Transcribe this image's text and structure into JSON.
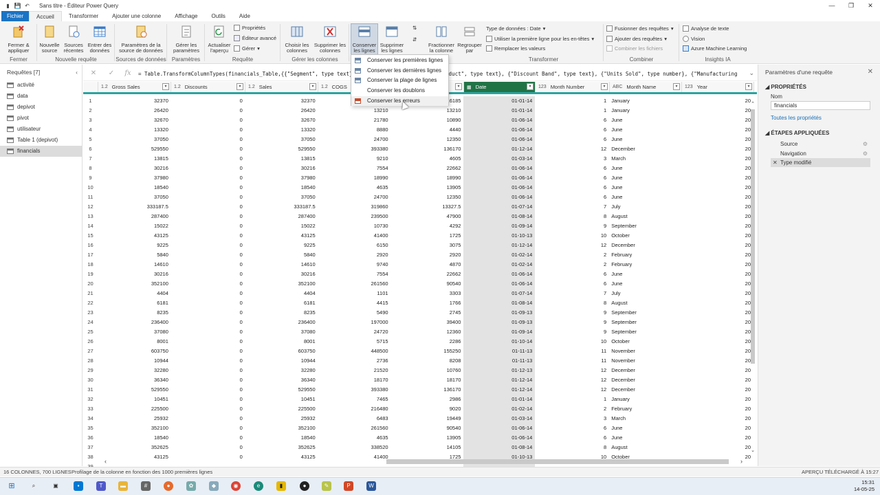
{
  "window": {
    "title": "Sans titre - Éditeur Power Query"
  },
  "menu": {
    "tabs": [
      "Fichier",
      "Accueil",
      "Transformer",
      "Ajouter une colonne",
      "Affichage",
      "Outils",
      "Aide"
    ]
  },
  "ribbon": {
    "close_apply": "Fermer &\nappliquer",
    "new_source": "Nouvelle\nsource",
    "recent_sources": "Sources\nrécentes",
    "enter_data": "Entrer des\ndonnées",
    "source_settings": "Paramètres de la\nsource de données",
    "manage_params": "Gérer les\nparamètres",
    "refresh_preview": "Actualiser\nl'aperçu",
    "properties": "Propriétés",
    "advanced_editor": "Éditeur avancé",
    "manage": "Gérer",
    "choose_columns": "Choisir les\ncolonnes",
    "remove_columns": "Supprimer les\ncolonnes",
    "keep_rows": "Conserver\nles lignes",
    "remove_rows": "Supprimer\nles lignes",
    "split_column": "Fractionner\nla colonne",
    "group_by": "Regrouper\npar",
    "data_type": "Type de données : Date",
    "first_row_headers": "Utiliser la première ligne pour les en-têtes",
    "replace_values": "Remplacer les valeurs",
    "merge_queries": "Fusionner des requêtes",
    "append_queries": "Ajouter des requêtes",
    "combine_files": "Combiner les fichiers",
    "text_analytics": "Analyse de texte",
    "vision": "Vision",
    "azure_ml": "Azure Machine Learning",
    "groups": {
      "close": "Fermer",
      "new_query": "Nouvelle requête",
      "data_sources": "Sources de données",
      "parameters": "Paramètres",
      "query": "Requête",
      "manage_columns": "Gérer les colonnes",
      "transform": "Transformer",
      "combine": "Combiner",
      "ai_insights": "Insights IA"
    }
  },
  "dropdown": {
    "items": [
      "Conserver les premières lignes",
      "Conserver les dernières lignes",
      "Conserver la plage de lignes",
      "Conserver les doublons",
      "Conserver les erreurs"
    ]
  },
  "queries": {
    "header": "Requêtes [7]",
    "items": [
      "activité",
      "data",
      "depivot",
      "pivot",
      "utilisateur",
      "Table 1 (depivot)",
      "financials"
    ]
  },
  "formula": {
    "text": "= Table.TransformColumnTypes(financials_Table,{{\"Segment\", type text}, {\"Country\", type text}, {\"Product\", type text}, {\"Discount Band\", type text}, {\"Units Sold\", type number}, {\"Manufacturing"
  },
  "grid": {
    "columns": [
      {
        "type": "1.2",
        "name": "Gross Sales"
      },
      {
        "type": "1.2",
        "name": "Discounts"
      },
      {
        "type": "1.2",
        "name": "Sales"
      },
      {
        "type": "1.2",
        "name": "COGS"
      },
      {
        "type": "1.2",
        "name": "Profit"
      },
      {
        "type": "▦",
        "name": "Date"
      },
      {
        "type": "123",
        "name": "Month Number"
      },
      {
        "type": "ABC",
        "name": "Month Name"
      },
      {
        "type": "123",
        "name": "Year"
      }
    ],
    "rows": [
      [
        "1",
        "32370",
        "0",
        "32370",
        "16185",
        "16185",
        "01-01-14",
        "1",
        "January",
        "20"
      ],
      [
        "2",
        "26420",
        "0",
        "26420",
        "13210",
        "13210",
        "01-01-14",
        "1",
        "January",
        "20"
      ],
      [
        "3",
        "32670",
        "0",
        "32670",
        "21780",
        "10890",
        "01-06-14",
        "6",
        "June",
        "20"
      ],
      [
        "4",
        "13320",
        "0",
        "13320",
        "8880",
        "4440",
        "01-06-14",
        "6",
        "June",
        "20"
      ],
      [
        "5",
        "37050",
        "0",
        "37050",
        "24700",
        "12350",
        "01-06-14",
        "6",
        "June",
        "20"
      ],
      [
        "6",
        "529550",
        "0",
        "529550",
        "393380",
        "136170",
        "01-12-14",
        "12",
        "December",
        "20"
      ],
      [
        "7",
        "13815",
        "0",
        "13815",
        "9210",
        "4605",
        "01-03-14",
        "3",
        "March",
        "20"
      ],
      [
        "8",
        "30216",
        "0",
        "30216",
        "7554",
        "22662",
        "01-06-14",
        "6",
        "June",
        "20"
      ],
      [
        "9",
        "37980",
        "0",
        "37980",
        "18990",
        "18990",
        "01-06-14",
        "6",
        "June",
        "20"
      ],
      [
        "10",
        "18540",
        "0",
        "18540",
        "4635",
        "13905",
        "01-06-14",
        "6",
        "June",
        "20"
      ],
      [
        "11",
        "37050",
        "0",
        "37050",
        "24700",
        "12350",
        "01-06-14",
        "6",
        "June",
        "20"
      ],
      [
        "12",
        "333187.5",
        "0",
        "333187.5",
        "319860",
        "13327.5",
        "01-07-14",
        "7",
        "July",
        "20"
      ],
      [
        "13",
        "287400",
        "0",
        "287400",
        "239500",
        "47900",
        "01-08-14",
        "8",
        "August",
        "20"
      ],
      [
        "14",
        "15022",
        "0",
        "15022",
        "10730",
        "4292",
        "01-09-14",
        "9",
        "September",
        "20"
      ],
      [
        "15",
        "43125",
        "0",
        "43125",
        "41400",
        "1725",
        "01-10-13",
        "10",
        "October",
        "20"
      ],
      [
        "16",
        "9225",
        "0",
        "9225",
        "6150",
        "3075",
        "01-12-14",
        "12",
        "December",
        "20"
      ],
      [
        "17",
        "5840",
        "0",
        "5840",
        "2920",
        "2920",
        "01-02-14",
        "2",
        "February",
        "20"
      ],
      [
        "18",
        "14610",
        "0",
        "14610",
        "9740",
        "4870",
        "01-02-14",
        "2",
        "February",
        "20"
      ],
      [
        "19",
        "30216",
        "0",
        "30216",
        "7554",
        "22662",
        "01-06-14",
        "6",
        "June",
        "20"
      ],
      [
        "20",
        "352100",
        "0",
        "352100",
        "261560",
        "90540",
        "01-06-14",
        "6",
        "June",
        "20"
      ],
      [
        "21",
        "4404",
        "0",
        "4404",
        "1101",
        "3303",
        "01-07-14",
        "7",
        "July",
        "20"
      ],
      [
        "22",
        "6181",
        "0",
        "6181",
        "4415",
        "1766",
        "01-08-14",
        "8",
        "August",
        "20"
      ],
      [
        "23",
        "8235",
        "0",
        "8235",
        "5490",
        "2745",
        "01-09-13",
        "9",
        "September",
        "20"
      ],
      [
        "24",
        "236400",
        "0",
        "236400",
        "197000",
        "39400",
        "01-09-13",
        "9",
        "September",
        "20"
      ],
      [
        "25",
        "37080",
        "0",
        "37080",
        "24720",
        "12360",
        "01-09-14",
        "9",
        "September",
        "20"
      ],
      [
        "26",
        "8001",
        "0",
        "8001",
        "5715",
        "2286",
        "01-10-14",
        "10",
        "October",
        "20"
      ],
      [
        "27",
        "603750",
        "0",
        "603750",
        "448500",
        "155250",
        "01-11-13",
        "11",
        "November",
        "20"
      ],
      [
        "28",
        "10944",
        "0",
        "10944",
        "2736",
        "8208",
        "01-11-13",
        "11",
        "November",
        "20"
      ],
      [
        "29",
        "32280",
        "0",
        "32280",
        "21520",
        "10760",
        "01-12-13",
        "12",
        "December",
        "20"
      ],
      [
        "30",
        "36340",
        "0",
        "36340",
        "18170",
        "18170",
        "01-12-14",
        "12",
        "December",
        "20"
      ],
      [
        "31",
        "529550",
        "0",
        "529550",
        "393380",
        "136170",
        "01-12-14",
        "12",
        "December",
        "20"
      ],
      [
        "32",
        "10451",
        "0",
        "10451",
        "7465",
        "2986",
        "01-01-14",
        "1",
        "January",
        "20"
      ],
      [
        "33",
        "225500",
        "0",
        "225500",
        "216480",
        "9020",
        "01-02-14",
        "2",
        "February",
        "20"
      ],
      [
        "34",
        "25932",
        "0",
        "25932",
        "6483",
        "19449",
        "01-03-14",
        "3",
        "March",
        "20"
      ],
      [
        "35",
        "352100",
        "0",
        "352100",
        "261560",
        "90540",
        "01-06-14",
        "6",
        "June",
        "20"
      ],
      [
        "36",
        "18540",
        "0",
        "18540",
        "4635",
        "13905",
        "01-06-14",
        "6",
        "June",
        "20"
      ],
      [
        "37",
        "352625",
        "0",
        "352625",
        "338520",
        "14105",
        "01-08-14",
        "8",
        "August",
        "20"
      ],
      [
        "38",
        "43125",
        "0",
        "43125",
        "41400",
        "1725",
        "01-10-13",
        "10",
        "October",
        "20"
      ],
      [
        "39",
        "",
        "",
        "",
        "",
        "",
        "",
        "",
        "",
        ""
      ]
    ]
  },
  "properties": {
    "title": "Paramètres d'une requête",
    "section_props": "PROPRIÉTÉS",
    "name_label": "Nom",
    "name_value": "financials",
    "all_props": "Toutes les propriétés",
    "section_steps": "ÉTAPES APPLIQUÉES",
    "steps": [
      "Source",
      "Navigation",
      "Type modifié"
    ]
  },
  "status": {
    "columns_rows": "16 COLONNES, 700 LIGNES",
    "profiling": "Profilage de la colonne en fonction des 1000 premières lignes",
    "preview": "APERÇU TÉLÉCHARGÉ À 15:27"
  },
  "taskbar": {
    "time": "15:31",
    "date": "14-05-25"
  },
  "colors": {
    "file_tab": "#1a73c5",
    "selected_col": "#217346",
    "accent_line": "#2aa3a0"
  }
}
